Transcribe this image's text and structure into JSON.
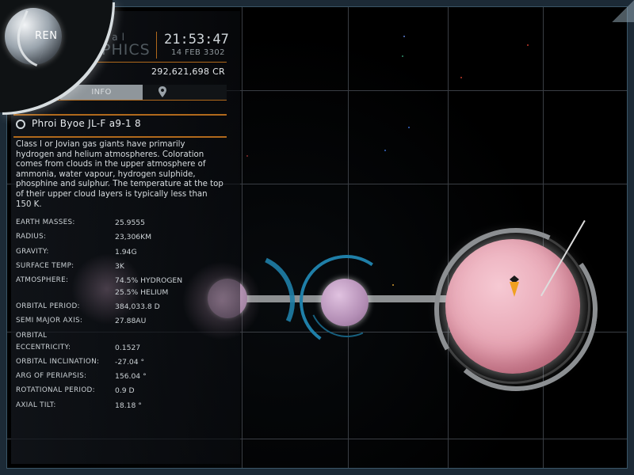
{
  "header": {
    "org_partial": "sal",
    "org_name_partial": "APHICS",
    "time": "21:53:47",
    "date": "14 FEB 3302",
    "credits": "292,621,698 CR",
    "emblem_label": "REN"
  },
  "tabs": [
    {
      "label": "INFO",
      "active": true
    },
    {
      "label": "",
      "icon": "map-pin-icon"
    }
  ],
  "body": {
    "name": "Phroi Byoe JL-F a9-1 8",
    "description": "Class I or Jovian gas giants have primarily hydrogen and helium atmospheres. Coloration comes from clouds in the upper atmosphere of ammonia, water vapour, hydrogen sulphide, phosphine and sulphur. The temperature at the top of their upper cloud layers is typically less than 150 K.",
    "stats": {
      "earth_masses": {
        "label": "EARTH MASSES:",
        "value": "25.9555"
      },
      "radius": {
        "label": "RADIUS:",
        "value": "23,306KM"
      },
      "gravity": {
        "label": "GRAVITY:",
        "value": "1.94G"
      },
      "surface_temp": {
        "label": "SURFACE TEMP:",
        "value": "3K"
      },
      "atmosphere": {
        "label": "ATMOSPHERE:",
        "value1": "74.5% HYDROGEN",
        "value2": "25.5% HELIUM"
      },
      "orbital_period": {
        "label": "ORBITAL PERIOD:",
        "value": "384,033.8 D"
      },
      "semi_major_axis": {
        "label": "SEMI MAJOR AXIS:",
        "value": "27.88AU"
      },
      "orbital_eccentricity": {
        "label1": "ORBITAL",
        "label2": "ECCENTRICITY:",
        "value": "0.1527"
      },
      "orbital_inclination": {
        "label": "ORBITAL INCLINATION:",
        "value": "-27.04 °"
      },
      "arg_of_periapsis": {
        "label": "ARG OF PERIAPSIS:",
        "value": "156.04 °"
      },
      "rotational_period": {
        "label": "ROTATIONAL PERIOD:",
        "value": "0.9 D"
      },
      "axial_tilt": {
        "label": "AXIAL TILT:",
        "value": "18.18 °"
      }
    }
  },
  "colors": {
    "accent_orange": "#b0691c",
    "planet_pink": "#e9aab8",
    "moon_lilac": "#c9a3c8",
    "ring_blue": "#1f7fa8",
    "marker_orange": "#f0a020"
  }
}
